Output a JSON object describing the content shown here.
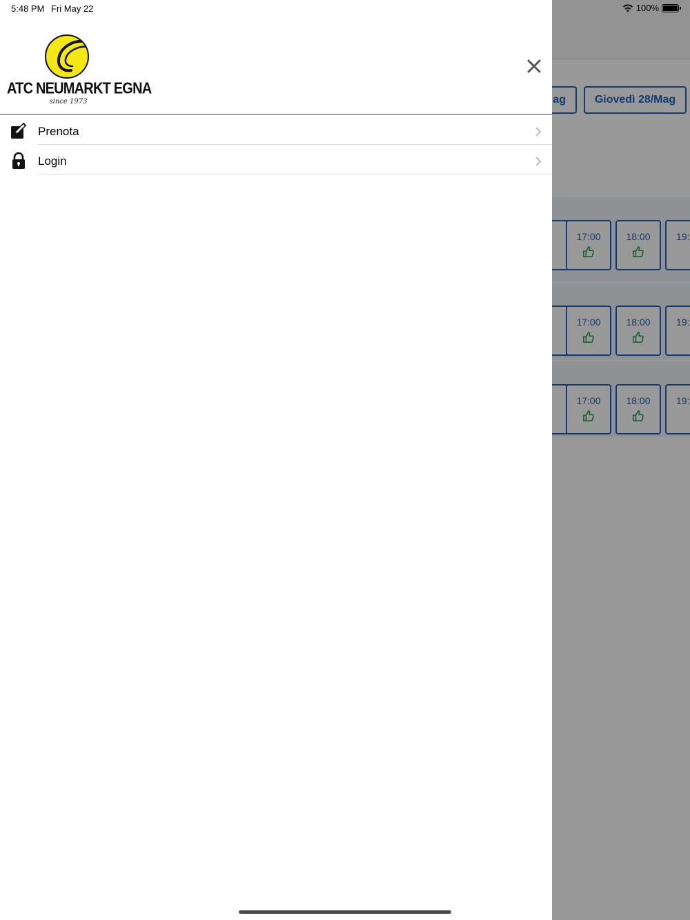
{
  "status_bar": {
    "time": "5:48 PM",
    "date": "Fri May 22",
    "battery": "100%"
  },
  "drawer": {
    "logo": {
      "name": "ATC NEUMARKT EGNA",
      "tagline": "since 1973"
    },
    "menu": [
      {
        "label": "Prenota",
        "icon": "edit-icon"
      },
      {
        "label": "Login",
        "icon": "lock-icon"
      }
    ]
  },
  "background": {
    "days": [
      {
        "label": "ag"
      },
      {
        "label": "Giovedì 28/Mag"
      }
    ],
    "slot_rows": [
      {
        "slots": [
          {
            "time": "17:00"
          },
          {
            "time": "18:00"
          },
          {
            "time": "19:"
          }
        ]
      },
      {
        "slots": [
          {
            "time": "17:00"
          },
          {
            "time": "18:00"
          },
          {
            "time": "19:"
          }
        ]
      },
      {
        "slots": [
          {
            "time": "17:00"
          },
          {
            "time": "18:00"
          },
          {
            "time": "19:"
          }
        ]
      }
    ],
    "available_icon": "thumbs-up-icon",
    "accent_color": "#1f5fbf",
    "available_color": "#2e9e5a"
  },
  "colors": {
    "logo_yellow": "#f5e616",
    "overlay": "rgba(0,0,0,0.40)"
  }
}
